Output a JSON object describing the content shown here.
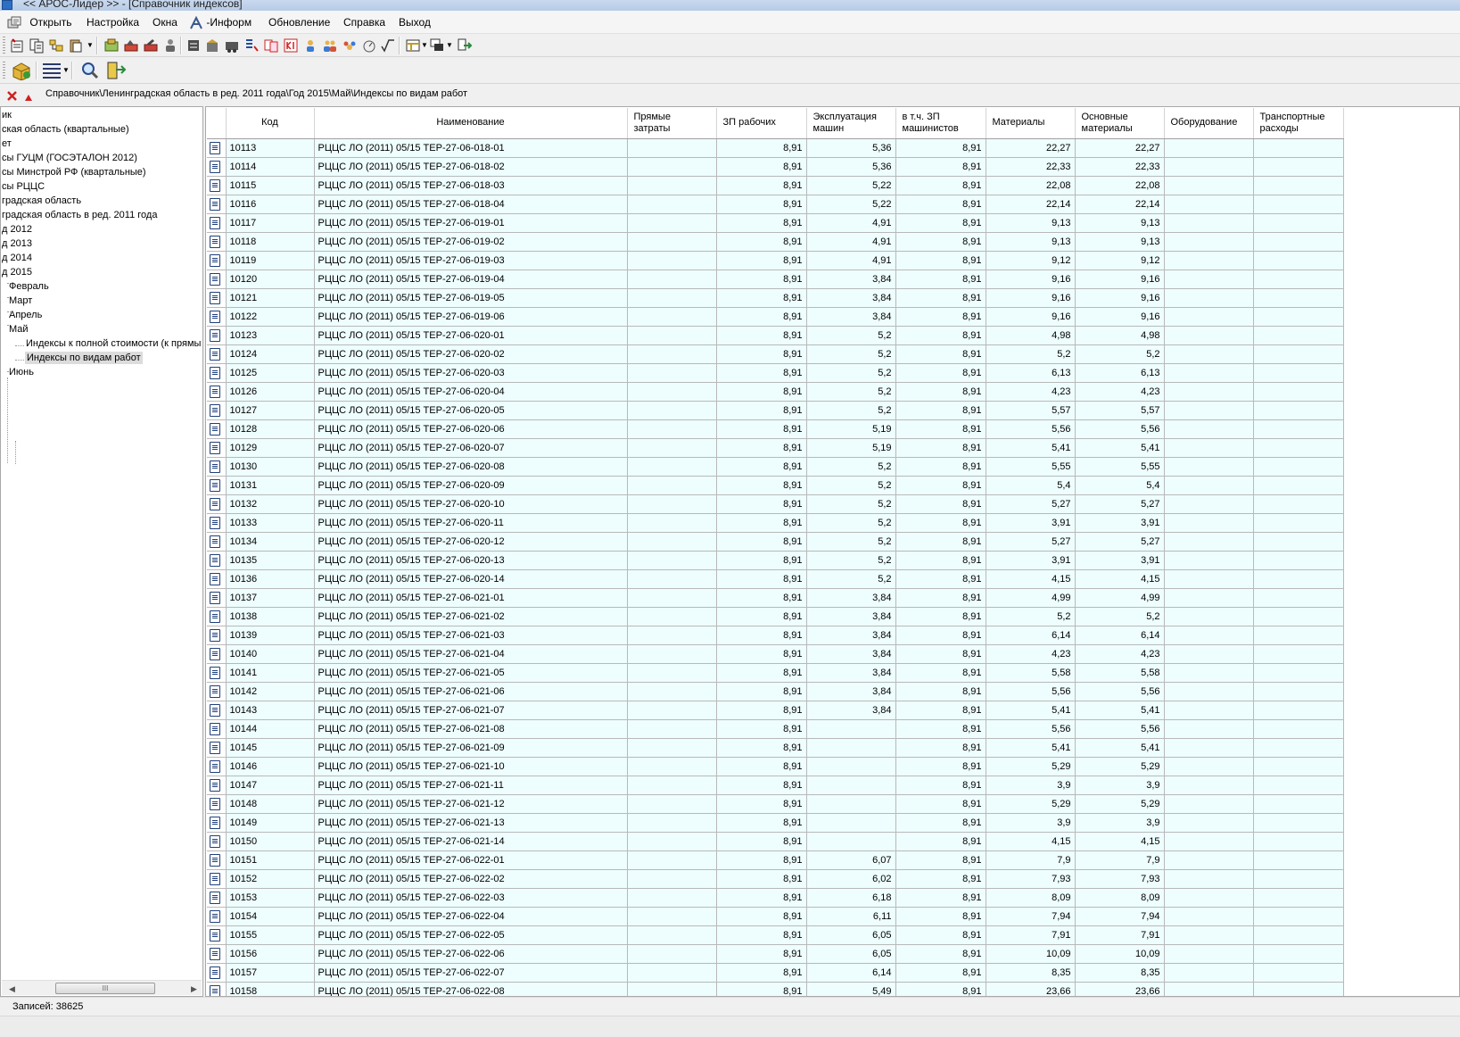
{
  "window": {
    "title": "<< АРОС-Лидер >> - [Справочник индексов]"
  },
  "menu": {
    "items": [
      {
        "label": "Открыть"
      },
      {
        "label": "Настройка"
      },
      {
        "label": "Окна"
      },
      {
        "label": "-Информ"
      },
      {
        "label": "Обновление"
      },
      {
        "label": "Справка"
      },
      {
        "label": "Выход"
      }
    ]
  },
  "path": "Справочник\\Ленинградская область в ред. 2011 года\\Год 2015\\Май\\Индексы по видам работ",
  "tree": {
    "nodes": [
      {
        "label": "ик"
      },
      {
        "label": "ская область (квартальные)"
      },
      {
        "label": "ет"
      },
      {
        "label": "сы ГУЦМ (ГОСЭТАЛОН 2012)"
      },
      {
        "label": "сы Минстрой РФ (квартальные)"
      },
      {
        "label": "сы РЦЦС"
      },
      {
        "label": "градская область"
      },
      {
        "label": "градская область в ред. 2011 года"
      },
      {
        "label": "д 2012"
      },
      {
        "label": "д 2013"
      },
      {
        "label": "д 2014"
      },
      {
        "label": "д 2015"
      },
      {
        "label": "Февраль"
      },
      {
        "label": "Март"
      },
      {
        "label": "Апрель"
      },
      {
        "label": "Май"
      },
      {
        "label": "Индексы к полной стоимости (к прямы"
      },
      {
        "label": "Индексы по видам работ"
      },
      {
        "label": "Июнь"
      }
    ],
    "scroll_thumb": "III"
  },
  "table": {
    "columns": {
      "code": "Код",
      "name": "Наименование",
      "direct": "Прямые затраты",
      "zp": "ЗП рабочих",
      "expl": "Эксплуатация машин",
      "zpm": "в т.ч. ЗП машинистов",
      "mat": "Материалы",
      "osn": "Основные материалы",
      "obor": "Оборудование",
      "trans": "Транспортные расходы"
    },
    "rows": [
      {
        "code": "10113",
        "name": "РЦЦС ЛО (2011) 05/15 ТЕР-27-06-018-01",
        "direct": "",
        "zp": "8,91",
        "expl": "5,36",
        "zpm": "8,91",
        "mat": "22,27",
        "osn": "22,27",
        "obor": "",
        "trans": ""
      },
      {
        "code": "10114",
        "name": "РЦЦС ЛО (2011) 05/15 ТЕР-27-06-018-02",
        "direct": "",
        "zp": "8,91",
        "expl": "5,36",
        "zpm": "8,91",
        "mat": "22,33",
        "osn": "22,33",
        "obor": "",
        "trans": ""
      },
      {
        "code": "10115",
        "name": "РЦЦС ЛО (2011) 05/15 ТЕР-27-06-018-03",
        "direct": "",
        "zp": "8,91",
        "expl": "5,22",
        "zpm": "8,91",
        "mat": "22,08",
        "osn": "22,08",
        "obor": "",
        "trans": ""
      },
      {
        "code": "10116",
        "name": "РЦЦС ЛО (2011) 05/15 ТЕР-27-06-018-04",
        "direct": "",
        "zp": "8,91",
        "expl": "5,22",
        "zpm": "8,91",
        "mat": "22,14",
        "osn": "22,14",
        "obor": "",
        "trans": ""
      },
      {
        "code": "10117",
        "name": "РЦЦС ЛО (2011) 05/15 ТЕР-27-06-019-01",
        "direct": "",
        "zp": "8,91",
        "expl": "4,91",
        "zpm": "8,91",
        "mat": "9,13",
        "osn": "9,13",
        "obor": "",
        "trans": ""
      },
      {
        "code": "10118",
        "name": "РЦЦС ЛО (2011) 05/15 ТЕР-27-06-019-02",
        "direct": "",
        "zp": "8,91",
        "expl": "4,91",
        "zpm": "8,91",
        "mat": "9,13",
        "osn": "9,13",
        "obor": "",
        "trans": ""
      },
      {
        "code": "10119",
        "name": "РЦЦС ЛО (2011) 05/15 ТЕР-27-06-019-03",
        "direct": "",
        "zp": "8,91",
        "expl": "4,91",
        "zpm": "8,91",
        "mat": "9,12",
        "osn": "9,12",
        "obor": "",
        "trans": ""
      },
      {
        "code": "10120",
        "name": "РЦЦС ЛО (2011) 05/15 ТЕР-27-06-019-04",
        "direct": "",
        "zp": "8,91",
        "expl": "3,84",
        "zpm": "8,91",
        "mat": "9,16",
        "osn": "9,16",
        "obor": "",
        "trans": ""
      },
      {
        "code": "10121",
        "name": "РЦЦС ЛО (2011) 05/15 ТЕР-27-06-019-05",
        "direct": "",
        "zp": "8,91",
        "expl": "3,84",
        "zpm": "8,91",
        "mat": "9,16",
        "osn": "9,16",
        "obor": "",
        "trans": ""
      },
      {
        "code": "10122",
        "name": "РЦЦС ЛО (2011) 05/15 ТЕР-27-06-019-06",
        "direct": "",
        "zp": "8,91",
        "expl": "3,84",
        "zpm": "8,91",
        "mat": "9,16",
        "osn": "9,16",
        "obor": "",
        "trans": ""
      },
      {
        "code": "10123",
        "name": "РЦЦС ЛО (2011) 05/15 ТЕР-27-06-020-01",
        "direct": "",
        "zp": "8,91",
        "expl": "5,2",
        "zpm": "8,91",
        "mat": "4,98",
        "osn": "4,98",
        "obor": "",
        "trans": ""
      },
      {
        "code": "10124",
        "name": "РЦЦС ЛО (2011) 05/15 ТЕР-27-06-020-02",
        "direct": "",
        "zp": "8,91",
        "expl": "5,2",
        "zpm": "8,91",
        "mat": "5,2",
        "osn": "5,2",
        "obor": "",
        "trans": ""
      },
      {
        "code": "10125",
        "name": "РЦЦС ЛО (2011) 05/15 ТЕР-27-06-020-03",
        "direct": "",
        "zp": "8,91",
        "expl": "5,2",
        "zpm": "8,91",
        "mat": "6,13",
        "osn": "6,13",
        "obor": "",
        "trans": ""
      },
      {
        "code": "10126",
        "name": "РЦЦС ЛО (2011) 05/15 ТЕР-27-06-020-04",
        "direct": "",
        "zp": "8,91",
        "expl": "5,2",
        "zpm": "8,91",
        "mat": "4,23",
        "osn": "4,23",
        "obor": "",
        "trans": ""
      },
      {
        "code": "10127",
        "name": "РЦЦС ЛО (2011) 05/15 ТЕР-27-06-020-05",
        "direct": "",
        "zp": "8,91",
        "expl": "5,2",
        "zpm": "8,91",
        "mat": "5,57",
        "osn": "5,57",
        "obor": "",
        "trans": ""
      },
      {
        "code": "10128",
        "name": "РЦЦС ЛО (2011) 05/15 ТЕР-27-06-020-06",
        "direct": "",
        "zp": "8,91",
        "expl": "5,19",
        "zpm": "8,91",
        "mat": "5,56",
        "osn": "5,56",
        "obor": "",
        "trans": ""
      },
      {
        "code": "10129",
        "name": "РЦЦС ЛО (2011) 05/15 ТЕР-27-06-020-07",
        "direct": "",
        "zp": "8,91",
        "expl": "5,19",
        "zpm": "8,91",
        "mat": "5,41",
        "osn": "5,41",
        "obor": "",
        "trans": ""
      },
      {
        "code": "10130",
        "name": "РЦЦС ЛО (2011) 05/15 ТЕР-27-06-020-08",
        "direct": "",
        "zp": "8,91",
        "expl": "5,2",
        "zpm": "8,91",
        "mat": "5,55",
        "osn": "5,55",
        "obor": "",
        "trans": ""
      },
      {
        "code": "10131",
        "name": "РЦЦС ЛО (2011) 05/15 ТЕР-27-06-020-09",
        "direct": "",
        "zp": "8,91",
        "expl": "5,2",
        "zpm": "8,91",
        "mat": "5,4",
        "osn": "5,4",
        "obor": "",
        "trans": ""
      },
      {
        "code": "10132",
        "name": "РЦЦС ЛО (2011) 05/15 ТЕР-27-06-020-10",
        "direct": "",
        "zp": "8,91",
        "expl": "5,2",
        "zpm": "8,91",
        "mat": "5,27",
        "osn": "5,27",
        "obor": "",
        "trans": ""
      },
      {
        "code": "10133",
        "name": "РЦЦС ЛО (2011) 05/15 ТЕР-27-06-020-11",
        "direct": "",
        "zp": "8,91",
        "expl": "5,2",
        "zpm": "8,91",
        "mat": "3,91",
        "osn": "3,91",
        "obor": "",
        "trans": ""
      },
      {
        "code": "10134",
        "name": "РЦЦС ЛО (2011) 05/15 ТЕР-27-06-020-12",
        "direct": "",
        "zp": "8,91",
        "expl": "5,2",
        "zpm": "8,91",
        "mat": "5,27",
        "osn": "5,27",
        "obor": "",
        "trans": ""
      },
      {
        "code": "10135",
        "name": "РЦЦС ЛО (2011) 05/15 ТЕР-27-06-020-13",
        "direct": "",
        "zp": "8,91",
        "expl": "5,2",
        "zpm": "8,91",
        "mat": "3,91",
        "osn": "3,91",
        "obor": "",
        "trans": ""
      },
      {
        "code": "10136",
        "name": "РЦЦС ЛО (2011) 05/15 ТЕР-27-06-020-14",
        "direct": "",
        "zp": "8,91",
        "expl": "5,2",
        "zpm": "8,91",
        "mat": "4,15",
        "osn": "4,15",
        "obor": "",
        "trans": ""
      },
      {
        "code": "10137",
        "name": "РЦЦС ЛО (2011) 05/15 ТЕР-27-06-021-01",
        "direct": "",
        "zp": "8,91",
        "expl": "3,84",
        "zpm": "8,91",
        "mat": "4,99",
        "osn": "4,99",
        "obor": "",
        "trans": ""
      },
      {
        "code": "10138",
        "name": "РЦЦС ЛО (2011) 05/15 ТЕР-27-06-021-02",
        "direct": "",
        "zp": "8,91",
        "expl": "3,84",
        "zpm": "8,91",
        "mat": "5,2",
        "osn": "5,2",
        "obor": "",
        "trans": ""
      },
      {
        "code": "10139",
        "name": "РЦЦС ЛО (2011) 05/15 ТЕР-27-06-021-03",
        "direct": "",
        "zp": "8,91",
        "expl": "3,84",
        "zpm": "8,91",
        "mat": "6,14",
        "osn": "6,14",
        "obor": "",
        "trans": ""
      },
      {
        "code": "10140",
        "name": "РЦЦС ЛО (2011) 05/15 ТЕР-27-06-021-04",
        "direct": "",
        "zp": "8,91",
        "expl": "3,84",
        "zpm": "8,91",
        "mat": "4,23",
        "osn": "4,23",
        "obor": "",
        "trans": ""
      },
      {
        "code": "10141",
        "name": "РЦЦС ЛО (2011) 05/15 ТЕР-27-06-021-05",
        "direct": "",
        "zp": "8,91",
        "expl": "3,84",
        "zpm": "8,91",
        "mat": "5,58",
        "osn": "5,58",
        "obor": "",
        "trans": ""
      },
      {
        "code": "10142",
        "name": "РЦЦС ЛО (2011) 05/15 ТЕР-27-06-021-06",
        "direct": "",
        "zp": "8,91",
        "expl": "3,84",
        "zpm": "8,91",
        "mat": "5,56",
        "osn": "5,56",
        "obor": "",
        "trans": ""
      },
      {
        "code": "10143",
        "name": "РЦЦС ЛО (2011) 05/15 ТЕР-27-06-021-07",
        "direct": "",
        "zp": "8,91",
        "expl": "3,84",
        "zpm": "8,91",
        "mat": "5,41",
        "osn": "5,41",
        "obor": "",
        "trans": ""
      },
      {
        "code": "10144",
        "name": "РЦЦС ЛО (2011) 05/15 ТЕР-27-06-021-08",
        "direct": "",
        "zp": "8,91",
        "expl": "",
        "zpm": "8,91",
        "mat": "5,56",
        "osn": "5,56",
        "obor": "",
        "trans": ""
      },
      {
        "code": "10145",
        "name": "РЦЦС ЛО (2011) 05/15 ТЕР-27-06-021-09",
        "direct": "",
        "zp": "8,91",
        "expl": "",
        "zpm": "8,91",
        "mat": "5,41",
        "osn": "5,41",
        "obor": "",
        "trans": ""
      },
      {
        "code": "10146",
        "name": "РЦЦС ЛО (2011) 05/15 ТЕР-27-06-021-10",
        "direct": "",
        "zp": "8,91",
        "expl": "",
        "zpm": "8,91",
        "mat": "5,29",
        "osn": "5,29",
        "obor": "",
        "trans": ""
      },
      {
        "code": "10147",
        "name": "РЦЦС ЛО (2011) 05/15 ТЕР-27-06-021-11",
        "direct": "",
        "zp": "8,91",
        "expl": "",
        "zpm": "8,91",
        "mat": "3,9",
        "osn": "3,9",
        "obor": "",
        "trans": ""
      },
      {
        "code": "10148",
        "name": "РЦЦС ЛО (2011) 05/15 ТЕР-27-06-021-12",
        "direct": "",
        "zp": "8,91",
        "expl": "",
        "zpm": "8,91",
        "mat": "5,29",
        "osn": "5,29",
        "obor": "",
        "trans": ""
      },
      {
        "code": "10149",
        "name": "РЦЦС ЛО (2011) 05/15 ТЕР-27-06-021-13",
        "direct": "",
        "zp": "8,91",
        "expl": "",
        "zpm": "8,91",
        "mat": "3,9",
        "osn": "3,9",
        "obor": "",
        "trans": ""
      },
      {
        "code": "10150",
        "name": "РЦЦС ЛО (2011) 05/15 ТЕР-27-06-021-14",
        "direct": "",
        "zp": "8,91",
        "expl": "",
        "zpm": "8,91",
        "mat": "4,15",
        "osn": "4,15",
        "obor": "",
        "trans": ""
      },
      {
        "code": "10151",
        "name": "РЦЦС ЛО (2011) 05/15 ТЕР-27-06-022-01",
        "direct": "",
        "zp": "8,91",
        "expl": "6,07",
        "zpm": "8,91",
        "mat": "7,9",
        "osn": "7,9",
        "obor": "",
        "trans": ""
      },
      {
        "code": "10152",
        "name": "РЦЦС ЛО (2011) 05/15 ТЕР-27-06-022-02",
        "direct": "",
        "zp": "8,91",
        "expl": "6,02",
        "zpm": "8,91",
        "mat": "7,93",
        "osn": "7,93",
        "obor": "",
        "trans": ""
      },
      {
        "code": "10153",
        "name": "РЦЦС ЛО (2011) 05/15 ТЕР-27-06-022-03",
        "direct": "",
        "zp": "8,91",
        "expl": "6,18",
        "zpm": "8,91",
        "mat": "8,09",
        "osn": "8,09",
        "obor": "",
        "trans": ""
      },
      {
        "code": "10154",
        "name": "РЦЦС ЛО (2011) 05/15 ТЕР-27-06-022-04",
        "direct": "",
        "zp": "8,91",
        "expl": "6,11",
        "zpm": "8,91",
        "mat": "7,94",
        "osn": "7,94",
        "obor": "",
        "trans": ""
      },
      {
        "code": "10155",
        "name": "РЦЦС ЛО (2011) 05/15 ТЕР-27-06-022-05",
        "direct": "",
        "zp": "8,91",
        "expl": "6,05",
        "zpm": "8,91",
        "mat": "7,91",
        "osn": "7,91",
        "obor": "",
        "trans": ""
      },
      {
        "code": "10156",
        "name": "РЦЦС ЛО (2011) 05/15 ТЕР-27-06-022-06",
        "direct": "",
        "zp": "8,91",
        "expl": "6,05",
        "zpm": "8,91",
        "mat": "10,09",
        "osn": "10,09",
        "obor": "",
        "trans": ""
      },
      {
        "code": "10157",
        "name": "РЦЦС ЛО (2011) 05/15 ТЕР-27-06-022-07",
        "direct": "",
        "zp": "8,91",
        "expl": "6,14",
        "zpm": "8,91",
        "mat": "8,35",
        "osn": "8,35",
        "obor": "",
        "trans": ""
      },
      {
        "code": "10158",
        "name": "РЦЦС ЛО (2011) 05/15 ТЕР-27-06-022-08",
        "direct": "",
        "zp": "8,91",
        "expl": "5,49",
        "zpm": "8,91",
        "mat": "23,66",
        "osn": "23,66",
        "obor": "",
        "trans": ""
      }
    ]
  },
  "status": {
    "records": "Записей: 38625"
  }
}
